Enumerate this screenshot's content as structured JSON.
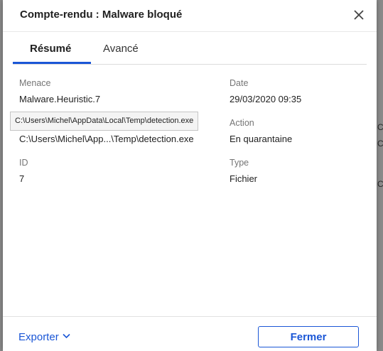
{
  "background": {
    "fragments": [
      "C:",
      "C:",
      "C:"
    ]
  },
  "dialog": {
    "title": "Compte-rendu : Malware bloqué",
    "tabs": [
      {
        "label": "Résumé",
        "active": true
      },
      {
        "label": "Avancé",
        "active": false
      }
    ],
    "fields": {
      "menace": {
        "label": "Menace",
        "value": "Malware.Heuristic.7"
      },
      "date": {
        "label": "Date",
        "value": "29/03/2020 09:35"
      },
      "path": {
        "value": "C:\\Users\\Michel\\App...\\Temp\\detection.exe"
      },
      "action": {
        "label": "Action",
        "value": "En quarantaine"
      },
      "id": {
        "label": "ID",
        "value": "7"
      },
      "type": {
        "label": "Type",
        "value": "Fichier"
      }
    },
    "tooltip": "C:\\Users\\Michel\\AppData\\Local\\Temp\\detection.exe",
    "footer": {
      "export_label": "Exporter",
      "close_label": "Fermer"
    }
  },
  "colors": {
    "accent": "#1a56d6",
    "overlay": "#8e8e8e"
  },
  "icons": {
    "close": "close-icon",
    "export": "chevron-down-icon"
  }
}
